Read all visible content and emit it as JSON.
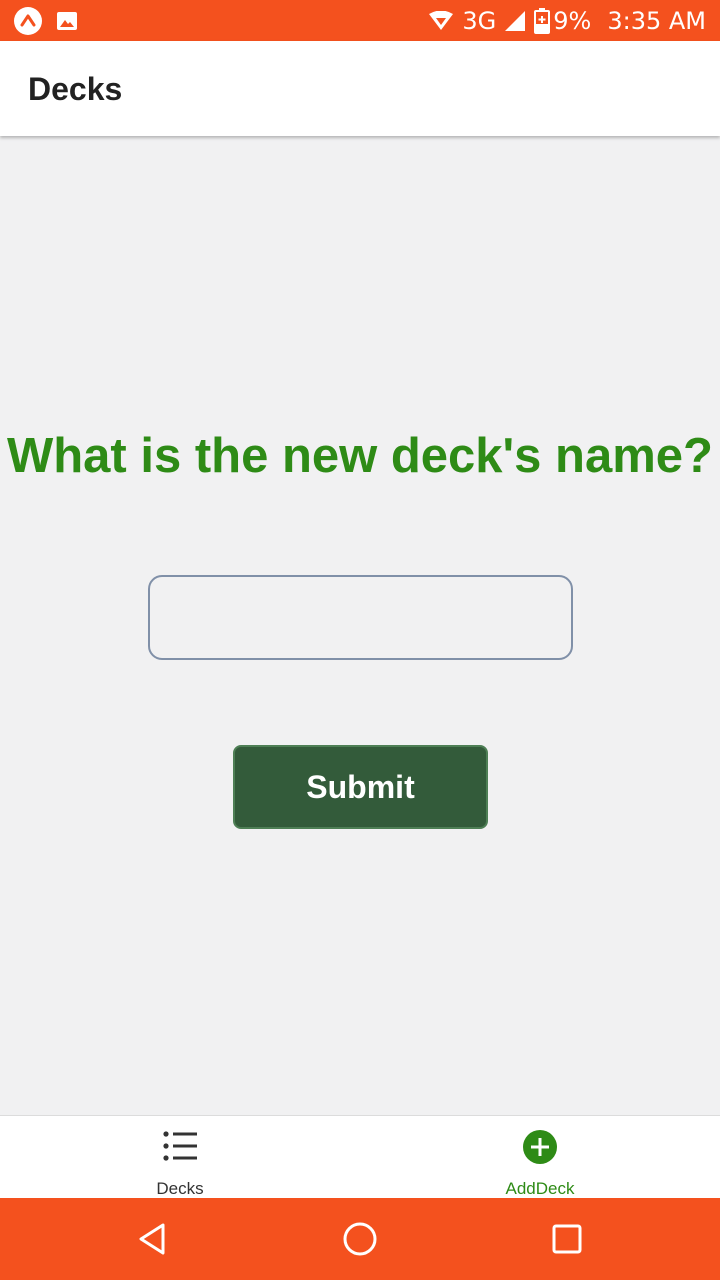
{
  "status_bar": {
    "network": "3G",
    "battery": "9%",
    "time": "3:35 AM"
  },
  "header": {
    "title": "Decks"
  },
  "form": {
    "prompt": "What is the new deck's name?",
    "input_value": "",
    "input_placeholder": "",
    "submit_label": "Submit"
  },
  "tabs": [
    {
      "label": "Decks",
      "icon": "list-icon",
      "active": false,
      "color": "#333333"
    },
    {
      "label": "AddDeck",
      "icon": "plus-circle-icon",
      "active": true,
      "color": "#2e8b16"
    }
  ],
  "colors": {
    "status_bar": "#f4511e",
    "accent": "#2e8b16",
    "button": "#335b3a"
  }
}
